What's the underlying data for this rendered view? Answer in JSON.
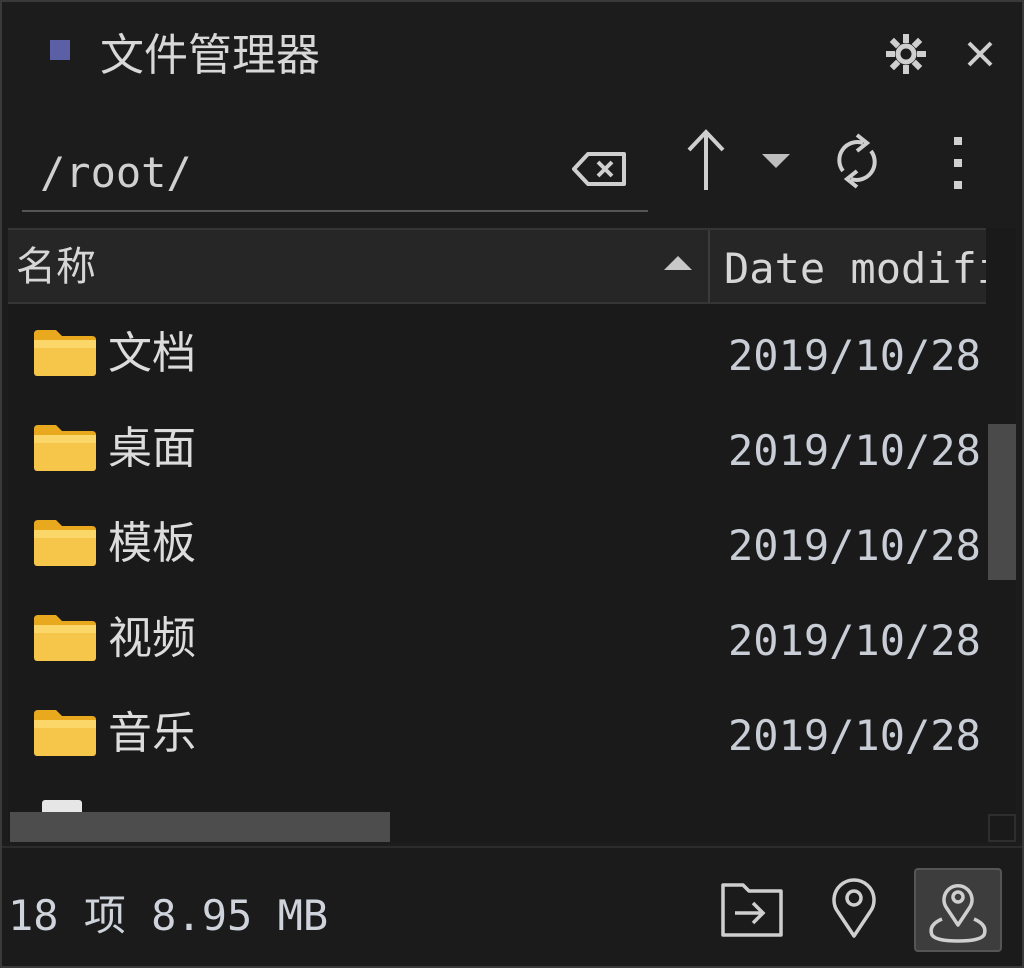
{
  "window": {
    "title": "文件管理器",
    "accent": "#5a5fa6"
  },
  "path": {
    "value": "/root/"
  },
  "columns": {
    "name": "名称",
    "date": "Date modified"
  },
  "rows": [
    {
      "name": "文档",
      "date": "2019/10/28",
      "icon": "folder-icon"
    },
    {
      "name": "桌面",
      "date": "2019/10/28",
      "icon": "folder-icon"
    },
    {
      "name": "模板",
      "date": "2019/10/28",
      "icon": "folder-icon"
    },
    {
      "name": "视频",
      "date": "2019/10/28",
      "icon": "folder-icon"
    },
    {
      "name": "音乐",
      "date": "2019/10/28",
      "icon": "folder-icon"
    }
  ],
  "status": {
    "summary": "18 项 8.95 MB"
  },
  "icons": {
    "settings": "gear-icon",
    "close": "close-icon",
    "clear": "clear-backspace-icon",
    "up": "arrow-up-icon",
    "history": "chevron-down-icon",
    "refresh": "refresh-icon",
    "more": "more-vertical-icon",
    "open_in": "folder-open-arrow-icon",
    "locate": "location-pin-icon",
    "locate_map": "map-pin-icon"
  },
  "colors": {
    "folder": "#f5c64a",
    "folder_tab": "#e9a91e"
  }
}
